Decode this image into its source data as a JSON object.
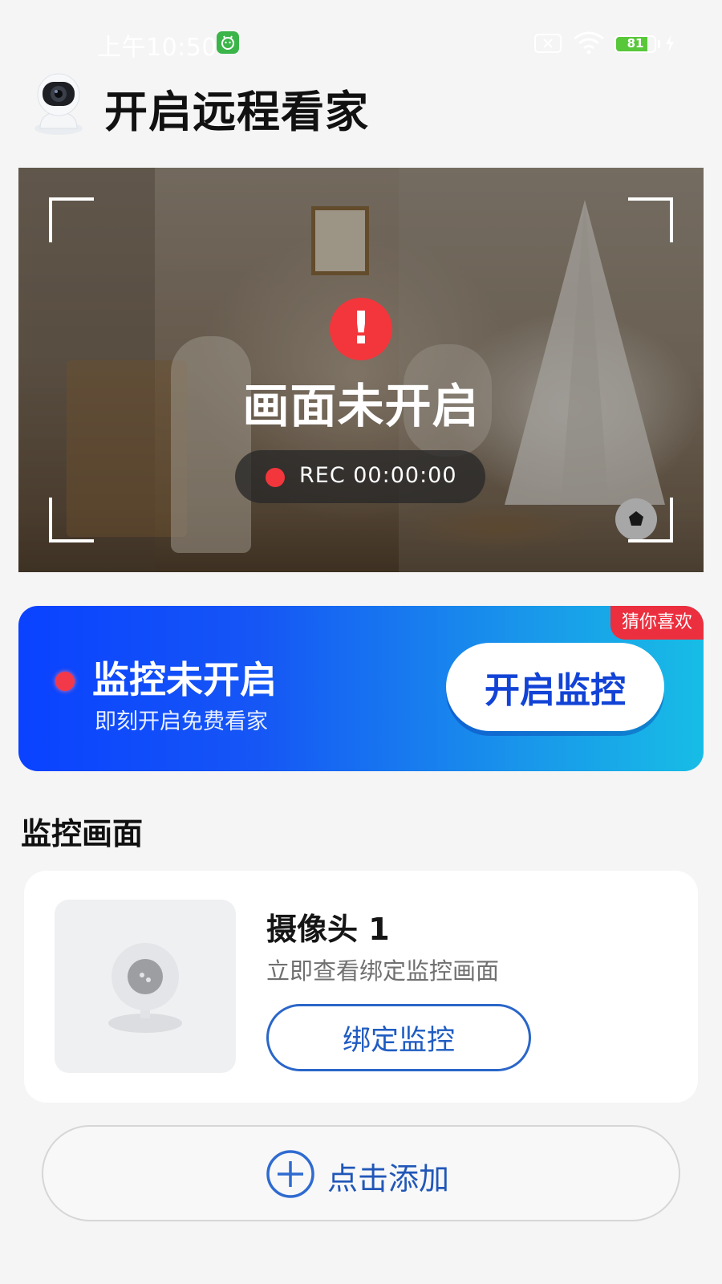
{
  "status_bar": {
    "time": "上午10:50",
    "battery_level": "81",
    "battery_fraction": 0.81,
    "icons": [
      "app-notification-icon",
      "sim-icon",
      "wifi-icon",
      "battery-icon",
      "charging-icon"
    ]
  },
  "header": {
    "title": "开启远程看家",
    "logo_icon": "security-camera-icon"
  },
  "preview": {
    "status_text": "画面未开启",
    "alert_icon_glyph": "!",
    "rec_text": "REC 00:00:00"
  },
  "promo": {
    "title": "监控未开启",
    "subtitle": "即刻开启免费看家",
    "button_label": "开启监控",
    "badge": "猜你喜欢"
  },
  "section": {
    "title": "监控画面"
  },
  "camera_card": {
    "name": "摄像头 1",
    "description": "立即查看绑定监控画面",
    "bind_label": "绑定监控"
  },
  "add": {
    "label": "点击添加"
  },
  "colors": {
    "accent": "#1f5cc2",
    "alert": "#f2363c",
    "promo_start": "#0a42ff",
    "promo_end": "#17bde6",
    "badge": "#ec2f3e",
    "page_bg": "#f5f5f5"
  }
}
